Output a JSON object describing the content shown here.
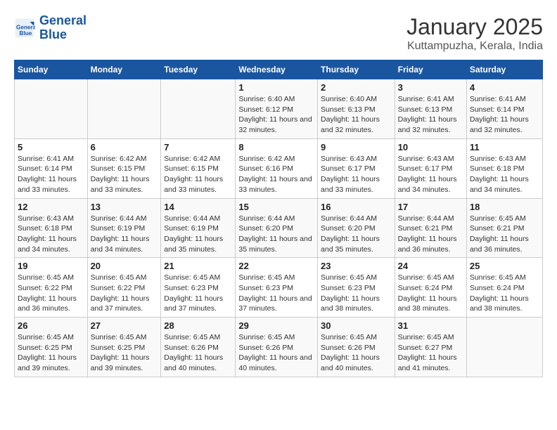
{
  "header": {
    "logo_line1": "General",
    "logo_line2": "Blue",
    "month": "January 2025",
    "location": "Kuttampuzha, Kerala, India"
  },
  "weekdays": [
    "Sunday",
    "Monday",
    "Tuesday",
    "Wednesday",
    "Thursday",
    "Friday",
    "Saturday"
  ],
  "weeks": [
    [
      {
        "day": "",
        "sunrise": "",
        "sunset": "",
        "daylight": ""
      },
      {
        "day": "",
        "sunrise": "",
        "sunset": "",
        "daylight": ""
      },
      {
        "day": "",
        "sunrise": "",
        "sunset": "",
        "daylight": ""
      },
      {
        "day": "1",
        "sunrise": "Sunrise: 6:40 AM",
        "sunset": "Sunset: 6:12 PM",
        "daylight": "Daylight: 11 hours and 32 minutes."
      },
      {
        "day": "2",
        "sunrise": "Sunrise: 6:40 AM",
        "sunset": "Sunset: 6:13 PM",
        "daylight": "Daylight: 11 hours and 32 minutes."
      },
      {
        "day": "3",
        "sunrise": "Sunrise: 6:41 AM",
        "sunset": "Sunset: 6:13 PM",
        "daylight": "Daylight: 11 hours and 32 minutes."
      },
      {
        "day": "4",
        "sunrise": "Sunrise: 6:41 AM",
        "sunset": "Sunset: 6:14 PM",
        "daylight": "Daylight: 11 hours and 32 minutes."
      }
    ],
    [
      {
        "day": "5",
        "sunrise": "Sunrise: 6:41 AM",
        "sunset": "Sunset: 6:14 PM",
        "daylight": "Daylight: 11 hours and 33 minutes."
      },
      {
        "day": "6",
        "sunrise": "Sunrise: 6:42 AM",
        "sunset": "Sunset: 6:15 PM",
        "daylight": "Daylight: 11 hours and 33 minutes."
      },
      {
        "day": "7",
        "sunrise": "Sunrise: 6:42 AM",
        "sunset": "Sunset: 6:15 PM",
        "daylight": "Daylight: 11 hours and 33 minutes."
      },
      {
        "day": "8",
        "sunrise": "Sunrise: 6:42 AM",
        "sunset": "Sunset: 6:16 PM",
        "daylight": "Daylight: 11 hours and 33 minutes."
      },
      {
        "day": "9",
        "sunrise": "Sunrise: 6:43 AM",
        "sunset": "Sunset: 6:17 PM",
        "daylight": "Daylight: 11 hours and 33 minutes."
      },
      {
        "day": "10",
        "sunrise": "Sunrise: 6:43 AM",
        "sunset": "Sunset: 6:17 PM",
        "daylight": "Daylight: 11 hours and 34 minutes."
      },
      {
        "day": "11",
        "sunrise": "Sunrise: 6:43 AM",
        "sunset": "Sunset: 6:18 PM",
        "daylight": "Daylight: 11 hours and 34 minutes."
      }
    ],
    [
      {
        "day": "12",
        "sunrise": "Sunrise: 6:43 AM",
        "sunset": "Sunset: 6:18 PM",
        "daylight": "Daylight: 11 hours and 34 minutes."
      },
      {
        "day": "13",
        "sunrise": "Sunrise: 6:44 AM",
        "sunset": "Sunset: 6:19 PM",
        "daylight": "Daylight: 11 hours and 34 minutes."
      },
      {
        "day": "14",
        "sunrise": "Sunrise: 6:44 AM",
        "sunset": "Sunset: 6:19 PM",
        "daylight": "Daylight: 11 hours and 35 minutes."
      },
      {
        "day": "15",
        "sunrise": "Sunrise: 6:44 AM",
        "sunset": "Sunset: 6:20 PM",
        "daylight": "Daylight: 11 hours and 35 minutes."
      },
      {
        "day": "16",
        "sunrise": "Sunrise: 6:44 AM",
        "sunset": "Sunset: 6:20 PM",
        "daylight": "Daylight: 11 hours and 35 minutes."
      },
      {
        "day": "17",
        "sunrise": "Sunrise: 6:44 AM",
        "sunset": "Sunset: 6:21 PM",
        "daylight": "Daylight: 11 hours and 36 minutes."
      },
      {
        "day": "18",
        "sunrise": "Sunrise: 6:45 AM",
        "sunset": "Sunset: 6:21 PM",
        "daylight": "Daylight: 11 hours and 36 minutes."
      }
    ],
    [
      {
        "day": "19",
        "sunrise": "Sunrise: 6:45 AM",
        "sunset": "Sunset: 6:22 PM",
        "daylight": "Daylight: 11 hours and 36 minutes."
      },
      {
        "day": "20",
        "sunrise": "Sunrise: 6:45 AM",
        "sunset": "Sunset: 6:22 PM",
        "daylight": "Daylight: 11 hours and 37 minutes."
      },
      {
        "day": "21",
        "sunrise": "Sunrise: 6:45 AM",
        "sunset": "Sunset: 6:23 PM",
        "daylight": "Daylight: 11 hours and 37 minutes."
      },
      {
        "day": "22",
        "sunrise": "Sunrise: 6:45 AM",
        "sunset": "Sunset: 6:23 PM",
        "daylight": "Daylight: 11 hours and 37 minutes."
      },
      {
        "day": "23",
        "sunrise": "Sunrise: 6:45 AM",
        "sunset": "Sunset: 6:23 PM",
        "daylight": "Daylight: 11 hours and 38 minutes."
      },
      {
        "day": "24",
        "sunrise": "Sunrise: 6:45 AM",
        "sunset": "Sunset: 6:24 PM",
        "daylight": "Daylight: 11 hours and 38 minutes."
      },
      {
        "day": "25",
        "sunrise": "Sunrise: 6:45 AM",
        "sunset": "Sunset: 6:24 PM",
        "daylight": "Daylight: 11 hours and 38 minutes."
      }
    ],
    [
      {
        "day": "26",
        "sunrise": "Sunrise: 6:45 AM",
        "sunset": "Sunset: 6:25 PM",
        "daylight": "Daylight: 11 hours and 39 minutes."
      },
      {
        "day": "27",
        "sunrise": "Sunrise: 6:45 AM",
        "sunset": "Sunset: 6:25 PM",
        "daylight": "Daylight: 11 hours and 39 minutes."
      },
      {
        "day": "28",
        "sunrise": "Sunrise: 6:45 AM",
        "sunset": "Sunset: 6:26 PM",
        "daylight": "Daylight: 11 hours and 40 minutes."
      },
      {
        "day": "29",
        "sunrise": "Sunrise: 6:45 AM",
        "sunset": "Sunset: 6:26 PM",
        "daylight": "Daylight: 11 hours and 40 minutes."
      },
      {
        "day": "30",
        "sunrise": "Sunrise: 6:45 AM",
        "sunset": "Sunset: 6:26 PM",
        "daylight": "Daylight: 11 hours and 40 minutes."
      },
      {
        "day": "31",
        "sunrise": "Sunrise: 6:45 AM",
        "sunset": "Sunset: 6:27 PM",
        "daylight": "Daylight: 11 hours and 41 minutes."
      },
      {
        "day": "",
        "sunrise": "",
        "sunset": "",
        "daylight": ""
      }
    ]
  ]
}
